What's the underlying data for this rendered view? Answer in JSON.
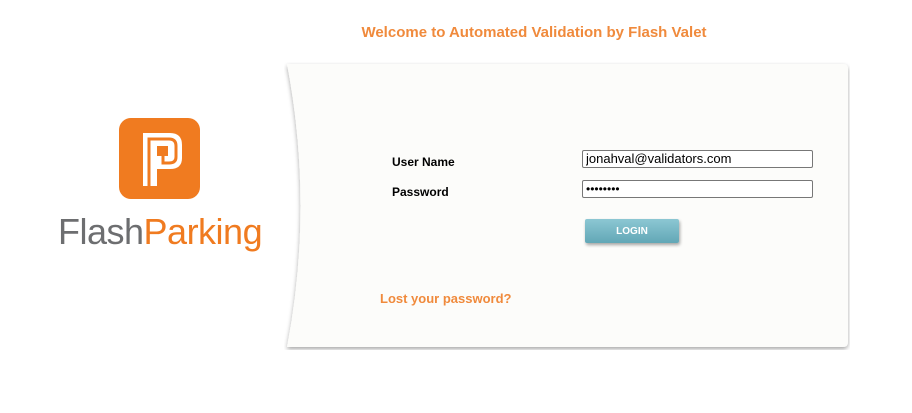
{
  "header": {
    "welcome": "Welcome to Automated Validation by Flash Valet"
  },
  "logo": {
    "word_flash": "Flash",
    "word_parking": "Parking",
    "brand_orange": "#f07b20",
    "brand_gray": "#6d6e70",
    "icon": "flashparking-logo-mark"
  },
  "login": {
    "username_label": "User Name",
    "username_value": "jonahval@validators.com",
    "password_label": "Password",
    "password_value": "••••••••",
    "login_button": "LOGIN",
    "lost_password": "Lost your password?"
  },
  "colors": {
    "accent": "#f08a3c",
    "button": "#6fb2c0",
    "card_background": "#fcfcfa"
  }
}
